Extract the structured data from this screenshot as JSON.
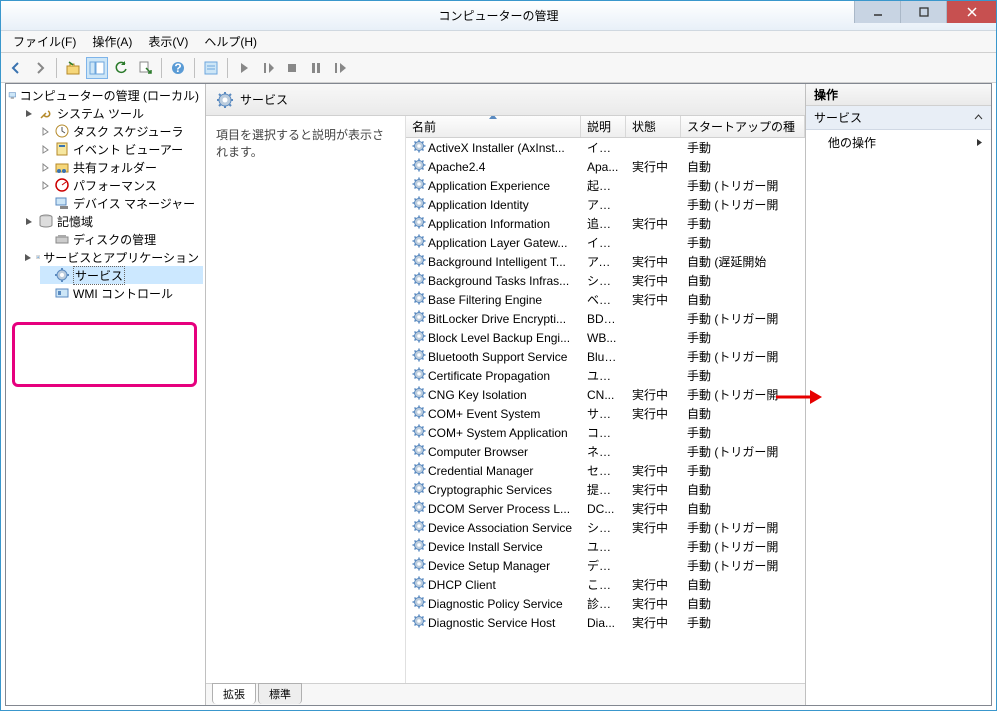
{
  "window": {
    "title": "コンピューターの管理"
  },
  "menu": {
    "file": "ファイル(F)",
    "action": "操作(A)",
    "view": "表示(V)",
    "help": "ヘルプ(H)"
  },
  "tree": {
    "root": "コンピューターの管理 (ローカル)",
    "system_tools": "システム ツール",
    "task_scheduler": "タスク スケジューラ",
    "event_viewer": "イベント ビューアー",
    "shared_folders": "共有フォルダー",
    "performance": "パフォーマンス",
    "device_manager": "デバイス マネージャー",
    "storage": "記憶域",
    "disk_management": "ディスクの管理",
    "services_apps": "サービスとアプリケーション",
    "services": "サービス",
    "wmi_control": "WMI コントロール"
  },
  "center": {
    "title": "サービス",
    "description_hint": "項目を選択すると説明が表示されます。"
  },
  "columns": {
    "name": "名前",
    "desc": "説明",
    "status": "状態",
    "startup": "スタートアップの種"
  },
  "tabs": {
    "extended": "拡張",
    "standard": "標準"
  },
  "actions": {
    "header": "操作",
    "section": "サービス",
    "other": "他の操作"
  },
  "services": [
    {
      "name": "ActiveX Installer (AxInst...",
      "desc": "イン...",
      "status": "",
      "startup": "手動"
    },
    {
      "name": "Apache2.4",
      "desc": "Apa...",
      "status": "実行中",
      "startup": "自動"
    },
    {
      "name": "Application Experience",
      "desc": "起動...",
      "status": "",
      "startup": "手動 (トリガー開"
    },
    {
      "name": "Application Identity",
      "desc": "アプリ...",
      "status": "",
      "startup": "手動 (トリガー開"
    },
    {
      "name": "Application Information",
      "desc": "追加...",
      "status": "実行中",
      "startup": "手動"
    },
    {
      "name": "Application Layer Gatew...",
      "desc": "イン...",
      "status": "",
      "startup": "手動"
    },
    {
      "name": "Background Intelligent T...",
      "desc": "アイ...",
      "status": "実行中",
      "startup": "自動 (遅延開始"
    },
    {
      "name": "Background Tasks Infras...",
      "desc": "シス...",
      "status": "実行中",
      "startup": "自動"
    },
    {
      "name": "Base Filtering Engine",
      "desc": "ベー...",
      "status": "実行中",
      "startup": "自動"
    },
    {
      "name": "BitLocker Drive Encrypti...",
      "desc": "BDE...",
      "status": "",
      "startup": "手動 (トリガー開"
    },
    {
      "name": "Block Level Backup Engi...",
      "desc": "WB...",
      "status": "",
      "startup": "手動"
    },
    {
      "name": "Bluetooth Support Service",
      "desc": "Blue...",
      "status": "",
      "startup": "手動 (トリガー開"
    },
    {
      "name": "Certificate Propagation",
      "desc": "ユー...",
      "status": "",
      "startup": "手動"
    },
    {
      "name": "CNG Key Isolation",
      "desc": "CN...",
      "status": "実行中",
      "startup": "手動 (トリガー開"
    },
    {
      "name": "COM+ Event System",
      "desc": "サポ...",
      "status": "実行中",
      "startup": "自動"
    },
    {
      "name": "COM+ System Application",
      "desc": "コン...",
      "status": "",
      "startup": "手動"
    },
    {
      "name": "Computer Browser",
      "desc": "ネット...",
      "status": "",
      "startup": "手動 (トリガー開"
    },
    {
      "name": "Credential Manager",
      "desc": "セキ...",
      "status": "実行中",
      "startup": "手動"
    },
    {
      "name": "Cryptographic Services",
      "desc": "提供...",
      "status": "実行中",
      "startup": "自動"
    },
    {
      "name": "DCOM Server Process L...",
      "desc": "DC...",
      "status": "実行中",
      "startup": "自動"
    },
    {
      "name": "Device Association Service",
      "desc": "シス...",
      "status": "実行中",
      "startup": "手動 (トリガー開"
    },
    {
      "name": "Device Install Service",
      "desc": "ユー...",
      "status": "",
      "startup": "手動 (トリガー開"
    },
    {
      "name": "Device Setup Manager",
      "desc": "デバ...",
      "status": "",
      "startup": "手動 (トリガー開"
    },
    {
      "name": "DHCP Client",
      "desc": "この...",
      "status": "実行中",
      "startup": "自動"
    },
    {
      "name": "Diagnostic Policy Service",
      "desc": "診断...",
      "status": "実行中",
      "startup": "自動"
    },
    {
      "name": "Diagnostic Service Host",
      "desc": "Dia...",
      "status": "実行中",
      "startup": "手動"
    }
  ]
}
